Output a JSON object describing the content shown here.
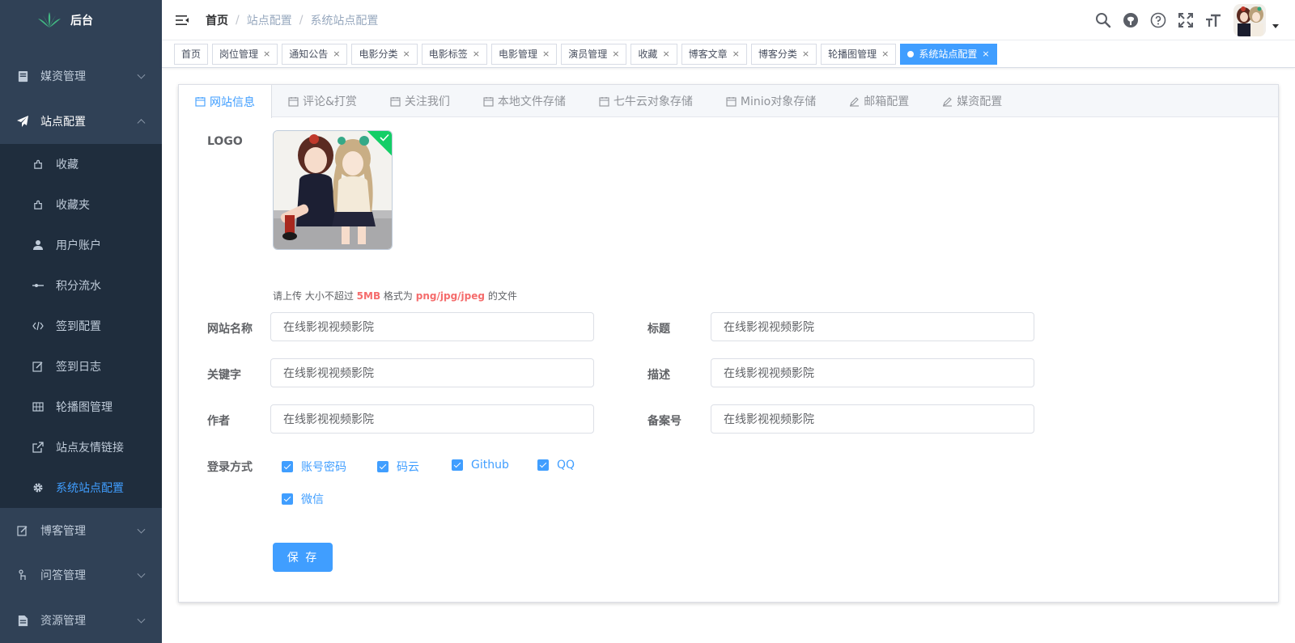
{
  "app": {
    "logo_text": "后台"
  },
  "sidebar": {
    "menus": [
      {
        "label": "媒资管理",
        "icon": "document-icon"
      },
      {
        "label": "站点配置",
        "icon": "paper-plane-icon"
      }
    ],
    "submenu": [
      {
        "label": "收藏",
        "icon": "puzzle-icon"
      },
      {
        "label": "收藏夹",
        "icon": "puzzle-icon"
      },
      {
        "label": "用户账户",
        "icon": "user-icon"
      },
      {
        "label": "积分流水",
        "icon": "commit-icon"
      },
      {
        "label": "签到配置",
        "icon": "code-icon"
      },
      {
        "label": "签到日志",
        "icon": "edit-icon"
      },
      {
        "label": "轮播图管理",
        "icon": "grid-icon"
      },
      {
        "label": "站点友情链接",
        "icon": "external-link-icon"
      },
      {
        "label": "系统站点配置",
        "icon": "gear-icon"
      }
    ],
    "bottom_menus": [
      {
        "label": "博客管理",
        "icon": "edit-icon"
      },
      {
        "label": "问答管理",
        "icon": "hand-icon"
      },
      {
        "label": "资源管理",
        "icon": "file-icon"
      }
    ]
  },
  "breadcrumb": [
    "首页",
    "站点配置",
    "系统站点配置"
  ],
  "tags": [
    "首页",
    "岗位管理",
    "通知公告",
    "电影分类",
    "电影标签",
    "电影管理",
    "演员管理",
    "收藏",
    "博客文章",
    "博客分类",
    "轮播图管理",
    "系统站点配置"
  ],
  "tabs": [
    "网站信息",
    "评论&打赏",
    "关注我们",
    "本地文件存储",
    "七牛云对象存储",
    "Minio对象存储",
    "邮箱配置",
    "媒资配置"
  ],
  "form": {
    "logo_label": "LOGO",
    "tip_prefix": "请上传 大小不超过",
    "tip_size": "5MB",
    "tip_mid": "格式为",
    "tip_format": "png/jpg/jpeg",
    "tip_suffix": "的文件",
    "fields": [
      {
        "label": "网站名称",
        "value": "在线影视视频影院"
      },
      {
        "label": "标题",
        "value": "在线影视视频影院"
      },
      {
        "label": "关键字",
        "value": "在线影视视频影院"
      },
      {
        "label": "描述",
        "value": "在线影视视频影院"
      },
      {
        "label": "作者",
        "value": "在线影视视频影院"
      },
      {
        "label": "备案号",
        "value": "在线影视视频影院"
      }
    ],
    "login_label": "登录方式",
    "login_options": [
      "账号密码",
      "码云",
      "Github",
      "QQ",
      "微信"
    ],
    "save_label": "保 存"
  },
  "colors": {
    "sidebar_bg": "#304156",
    "submenu_bg": "#1f2d3d",
    "primary": "#409eff",
    "danger": "#f56c6c",
    "success": "#13ce66"
  }
}
